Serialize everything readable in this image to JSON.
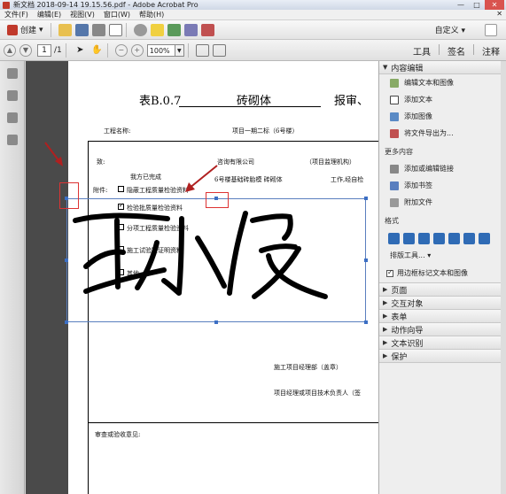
{
  "window": {
    "title": "新文档 2018-09-14 19.15.56.pdf - Adobe Acrobat Pro",
    "controls": [
      "—",
      "□",
      "✕"
    ]
  },
  "menu": {
    "items": [
      "文件(F)",
      "编辑(E)",
      "视图(V)",
      "窗口(W)",
      "帮助(H)"
    ],
    "close": "✕"
  },
  "toolbar": {
    "create_label": "创建",
    "custom_label": "自定义 ▾"
  },
  "nav": {
    "page_current": "1",
    "page_total": "/1",
    "zoom": "100%",
    "panels": [
      "工具",
      "签名",
      "注释"
    ]
  },
  "document": {
    "title_prefix": "表B.0.7",
    "title_main": "砖砌体",
    "title_suffix": "报审、",
    "project_label": "工程名称:",
    "project_value": "项目一期二标（6号楼）",
    "to_label": "致:",
    "to_company": "咨询有限公司",
    "to_suffix": "（项目监理机构）",
    "done_label": "我方已完成",
    "done_value": "6号楼基础砖胎模 砖砌体",
    "done_suffix": "工作,经自检",
    "attach_label": "附件:",
    "checklist": [
      {
        "label": "隐蔽工程质量检验资料",
        "checked": false
      },
      {
        "label": "检验批质量检验资料",
        "checked": true
      },
      {
        "label": "分项工程质量检验资料",
        "checked": false
      },
      {
        "label": "施工试验室证明资料",
        "checked": false
      },
      {
        "label": "其他",
        "checked": false
      }
    ],
    "pm_label": "施工项目经理部（盖章）",
    "tech_label": "项目经理或项目技术负责人（签",
    "review_label": "审查或验收意见:"
  },
  "right_panel": {
    "content_edit_header": "内容编辑",
    "items": [
      {
        "label": "编辑文本和图像",
        "icon": "edit-text-icon"
      },
      {
        "label": "添加文本",
        "icon": "add-text-icon"
      },
      {
        "label": "添加图像",
        "icon": "add-image-icon"
      },
      {
        "label": "将文件导出为...",
        "icon": "export-icon"
      }
    ],
    "more_label": "更多内容",
    "more_items": [
      {
        "label": "添加或编辑链接",
        "icon": "link-icon"
      },
      {
        "label": "添加书签",
        "icon": "bookmark-icon"
      },
      {
        "label": "附加文件",
        "icon": "attach-icon"
      }
    ],
    "format_label": "格式",
    "arrange_label": "排版工具...",
    "outline_label": "用边框标记文本和图像",
    "sections": [
      "页面",
      "交互对象",
      "表单",
      "动作向导",
      "文本识别",
      "保护"
    ]
  },
  "colors": {
    "accent": "#2f6bb5",
    "selection": "#3c6fc4",
    "annotation_red": "#d33333"
  }
}
